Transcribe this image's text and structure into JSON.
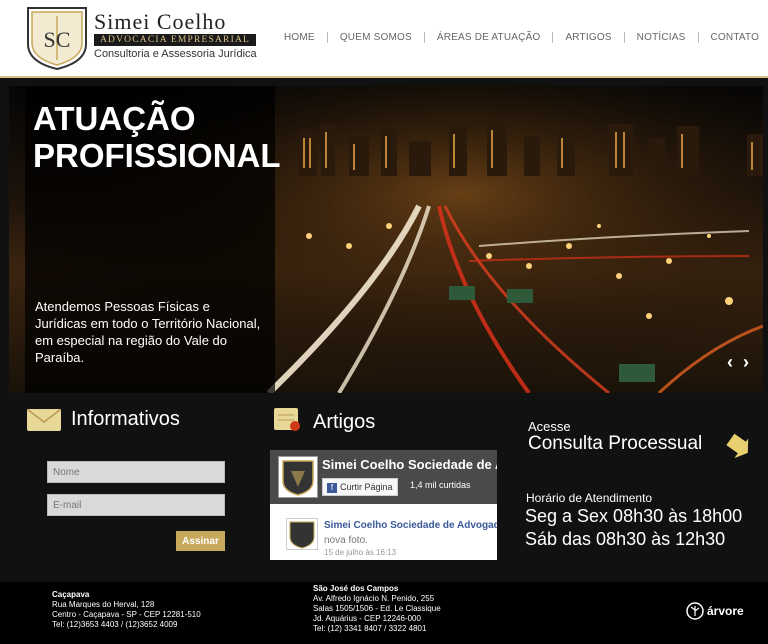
{
  "brand": {
    "name": "Simei Coelho",
    "band": "Advocacia Empresarial",
    "subtitle": "Consultoria e Assessoria Jurídica",
    "monogram": "SC"
  },
  "nav": {
    "items": [
      {
        "label": "HOME"
      },
      {
        "label": "QUEM SOMOS"
      },
      {
        "label": "ÁREAS DE ATUAÇÃO"
      },
      {
        "label": "ARTIGOS"
      },
      {
        "label": "NOTÍCIAS"
      },
      {
        "label": "CONTATO"
      }
    ]
  },
  "hero": {
    "title_line1": "Atuação",
    "title_line2": "Profissional",
    "text": "Atendemos Pessoas Físicas e Jurídicas em todo o Território Nacional, em especial na região do Vale do Paraíba.",
    "prev_icon": "‹",
    "next_icon": "›"
  },
  "informativos": {
    "title": "Informativos",
    "name_placeholder": "Nome",
    "email_placeholder": "E-mail",
    "button_label": "Assinar"
  },
  "artigos": {
    "title": "Artigos",
    "fb_page_name": "Simei Coelho Sociedade de Advogados",
    "fb_like_label": "Curtir Página",
    "fb_likes": "1,4 mil curtidas",
    "post_author": "Simei Coelho Sociedade de Advogados",
    "post_text": "nova foto.",
    "post_date": "15 de julho às 16:13"
  },
  "consulta": {
    "small": "Acesse",
    "big": "Consulta Processual",
    "hours_title": "Horário de Atendimento",
    "hours_line1": "Seg a Sex 08h30 às 18h00",
    "hours_line2": "Sáb das 08h30 às 12h30"
  },
  "footer": {
    "cacapava": {
      "city": "Caçapava",
      "line1": "Rua Marques do Herval, 128",
      "line2": "Centro - Caçapava - SP - CEP 12281-510",
      "line3": "Tel: (12)3653 4403 / (12)3652 4009"
    },
    "sjc": {
      "city": "São José dos Campos",
      "line1": "Av. Alfredo Ignácio N. Penido, 255",
      "line2": "Salas 1505/1506 - Ed. Le Classique",
      "line3": "Jd. Aquárius - CEP 12246-000",
      "line4": "Tel: (12) 3341 8407 / 3322 4801"
    },
    "credit": "árvore"
  },
  "colors": {
    "gold": "#c8a85a",
    "dark": "#111111",
    "fb_blue": "#3b5998"
  }
}
